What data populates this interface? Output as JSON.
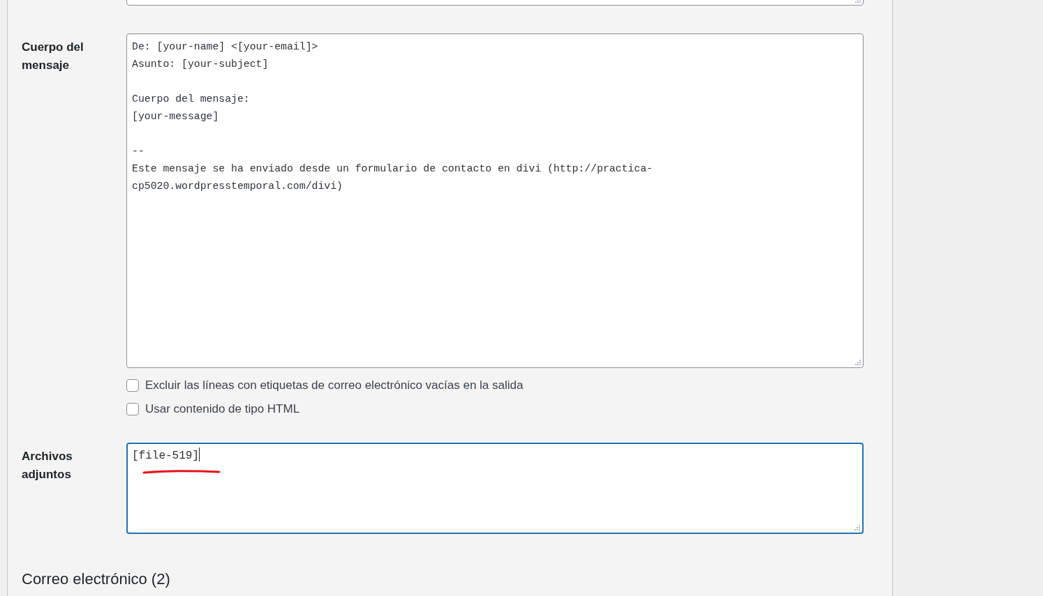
{
  "message_body": {
    "label": "Cuerpo del mensaje",
    "paragraphs": [
      [
        "De: [your-name] <[your-email]>",
        "Asunto: [your-subject]"
      ],
      [
        "Cuerpo del mensaje:",
        "[your-message]"
      ],
      [
        "--",
        "Este mensaje se ha enviado desde un formulario de contacto en divi (http://practica-",
        "cp5020.wordpresstemporal.com/divi)"
      ]
    ]
  },
  "options": [
    {
      "label": "Excluir las líneas con etiquetas de correo electrónico vacías en la salida",
      "checked": false
    },
    {
      "label": "Usar contenido de tipo HTML",
      "checked": false
    }
  ],
  "attachments": {
    "label": "Archivos adjuntos",
    "value": "[file-519]",
    "focused": true
  },
  "next_section": {
    "title": "Correo electrónico (2)"
  }
}
